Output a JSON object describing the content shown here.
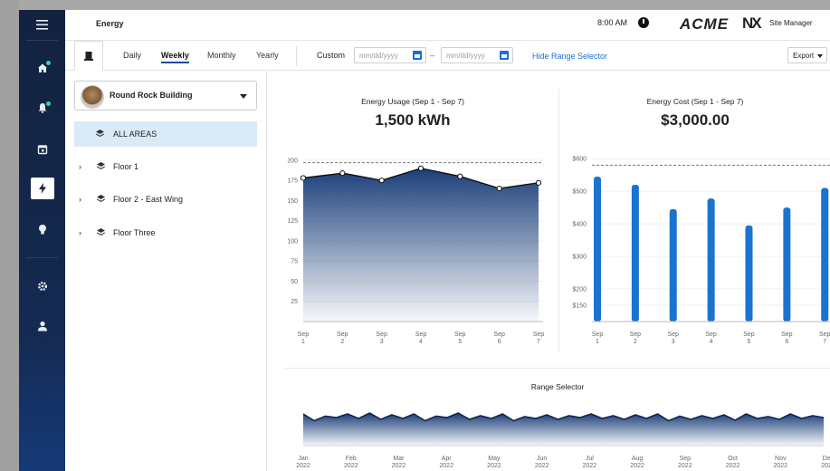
{
  "header": {
    "page_title": "Energy",
    "time": "8:00 AM",
    "brand": "ACME",
    "nx_logo": "NX",
    "site_manager": "Site Manager"
  },
  "sidebar": {
    "items": [
      {
        "name": "home",
        "icon": "home-icon"
      },
      {
        "name": "alerts",
        "icon": "bell-icon"
      },
      {
        "name": "calendar",
        "icon": "calendar-icon"
      },
      {
        "name": "energy",
        "icon": "bolt-icon",
        "active": true
      },
      {
        "name": "lighting",
        "icon": "bulb-icon"
      },
      {
        "name": "settings",
        "icon": "gear-icon"
      },
      {
        "name": "user",
        "icon": "user-icon"
      }
    ]
  },
  "toolbar": {
    "tabs": [
      "Daily",
      "Weekly",
      "Monthly",
      "Yearly"
    ],
    "selected_tab": "Weekly",
    "custom_label": "Custom",
    "date_from_placeholder": "mm/dd/yyyy",
    "date_to_placeholder": "mm/dd/yyyy",
    "range_dash": "–",
    "hide_range_link": "Hide Range Selector",
    "export_label": "Export"
  },
  "building": {
    "name": "Round Rock Building"
  },
  "areas": [
    {
      "label": "ALL AREAS",
      "selected": true,
      "expandable": false
    },
    {
      "label": "Floor 1",
      "selected": false,
      "expandable": true
    },
    {
      "label": "Floor 2 - East Wing",
      "selected": false,
      "expandable": true
    },
    {
      "label": "Floor Three",
      "selected": false,
      "expandable": true
    }
  ],
  "chart_data": [
    {
      "type": "area",
      "title": "Energy Usage (Sep 1 - Sep 7)",
      "headline": "1,500 kWh",
      "categories": [
        "Sep 1",
        "Sep 2",
        "Sep 3",
        "Sep 4",
        "Sep 5",
        "Sep 6",
        "Sep 7"
      ],
      "values": [
        178,
        184,
        175,
        190,
        180,
        165,
        172
      ],
      "threshold": 197,
      "yticks": [
        25,
        50,
        75,
        100,
        125,
        150,
        175,
        200
      ],
      "ylim": [
        0,
        210
      ],
      "color": "#1b3f7a"
    },
    {
      "type": "bar",
      "title": "Energy Cost (Sep 1 - Sep 7)",
      "headline": "$3,000.00",
      "categories": [
        "Sep 1",
        "Sep 2",
        "Sep 3",
        "Sep 4",
        "Sep 5",
        "Sep 6",
        "Sep 7"
      ],
      "values": [
        545,
        520,
        445,
        478,
        395,
        450,
        510
      ],
      "threshold": 580,
      "yticks": [
        "$150",
        "$200",
        "$300",
        "$400",
        "$500",
        "$600"
      ],
      "ylim": [
        100,
        620
      ],
      "color": "#1a74cf"
    },
    {
      "type": "area",
      "title": "Range Selector",
      "categories": [
        "Jan 2022",
        "Feb 2022",
        "Mar 2022",
        "Apr 2022",
        "May 2022",
        "Jun 2022",
        "Jul 2022",
        "Aug 2022",
        "Sep 2022",
        "Oct 2022",
        "Nov 2022",
        "Dec 2022"
      ],
      "values": [
        0.7,
        0.55,
        0.65,
        0.62,
        0.7,
        0.6,
        0.72,
        0.58,
        0.68,
        0.6,
        0.7,
        0.55,
        0.65,
        0.62,
        0.72,
        0.58,
        0.66,
        0.6,
        0.7,
        0.55,
        0.64,
        0.6,
        0.68,
        0.58,
        0.66,
        0.62,
        0.7,
        0.6,
        0.66,
        0.58,
        0.68,
        0.6,
        0.7,
        0.55,
        0.65,
        0.58,
        0.66,
        0.6,
        0.68,
        0.56,
        0.7,
        0.6,
        0.64,
        0.58,
        0.7,
        0.6,
        0.66,
        0.62
      ],
      "color": "#1b3f7a"
    }
  ]
}
